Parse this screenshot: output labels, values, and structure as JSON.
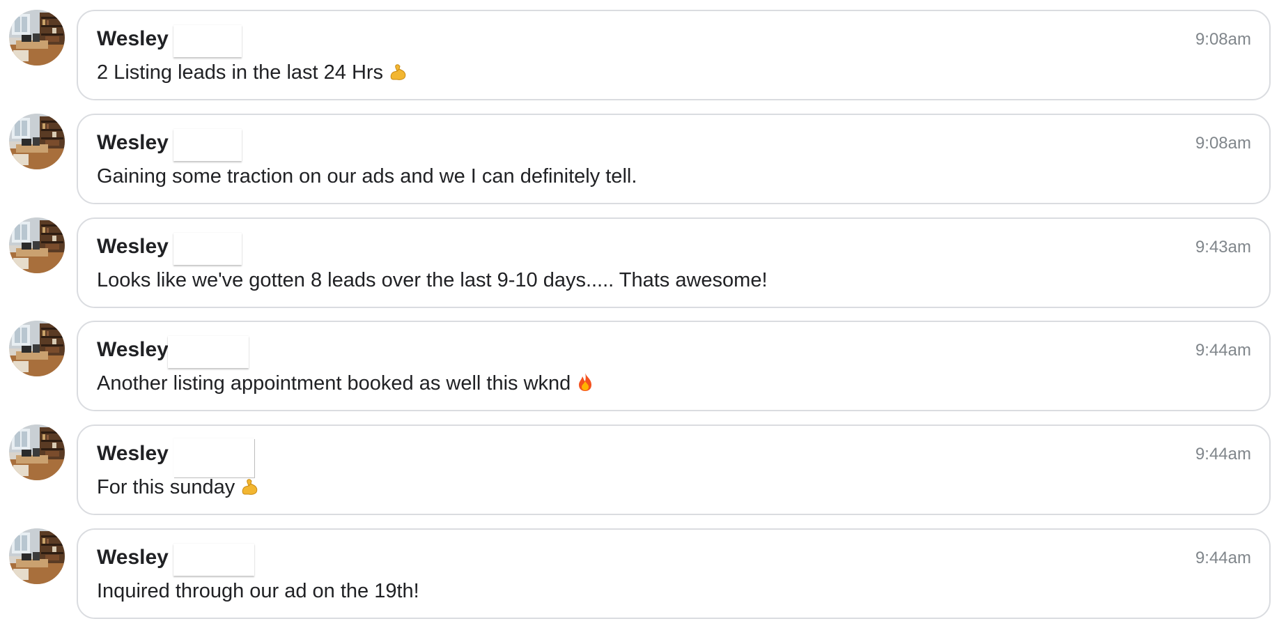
{
  "messages": [
    {
      "sender": "Wesley",
      "time": "9:08am",
      "text": "2 Listing leads in the last 24 Hrs",
      "emoji": "flexed-biceps-icon"
    },
    {
      "sender": "Wesley",
      "time": "9:08am",
      "text": "Gaining some traction on our ads and we I can definitely tell.",
      "emoji": ""
    },
    {
      "sender": "Wesley",
      "time": "9:43am",
      "text": "Looks like we've gotten 8 leads over the last 9-10 days..... Thats awesome!",
      "emoji": ""
    },
    {
      "sender": "Wesley",
      "time": "9:44am",
      "text": "Another listing appointment booked as well this wknd",
      "emoji": "fire-icon"
    },
    {
      "sender": "Wesley",
      "time": "9:44am",
      "text": "For this sunday",
      "emoji": "flexed-biceps-icon"
    },
    {
      "sender": "Wesley",
      "time": "9:44am",
      "text": "Inquired through our ad on the 19th!",
      "emoji": ""
    }
  ],
  "colors": {
    "bubble_border": "#dadce0",
    "timestamp": "#80868b",
    "text": "#202124"
  }
}
